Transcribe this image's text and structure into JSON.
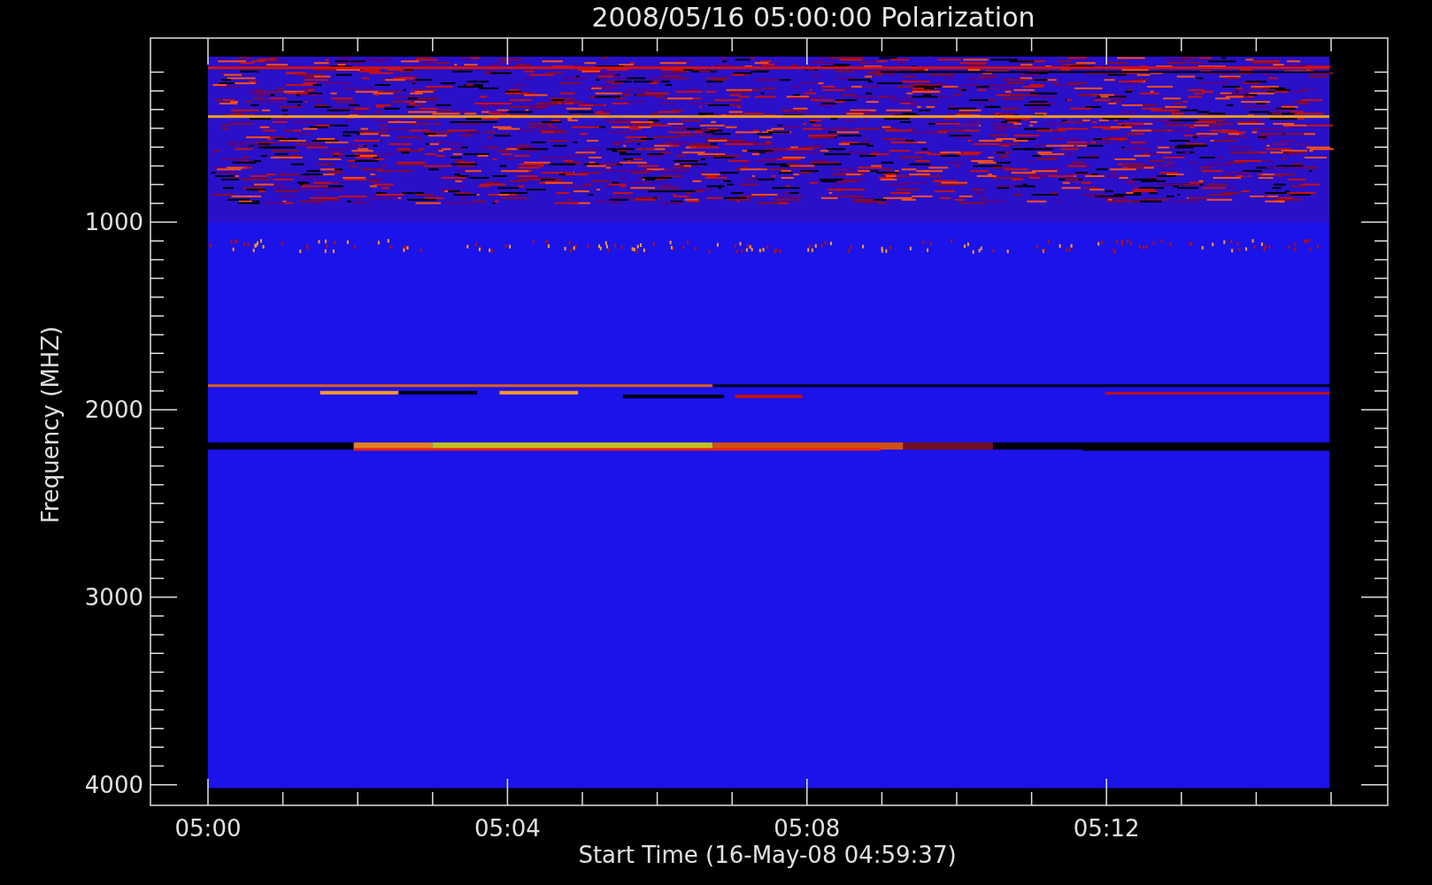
{
  "title": "2008/05/16 05:00:00 Polarization",
  "plot": {
    "ylabel": "Frequency (MHZ)",
    "xlabel": "Start Time (16-May-08 04:59:37)",
    "yticks": [
      "1000",
      "2000",
      "3000",
      "4000"
    ],
    "xticks": [
      "05:00",
      "05:04",
      "05:08",
      "05:12"
    ]
  }
}
